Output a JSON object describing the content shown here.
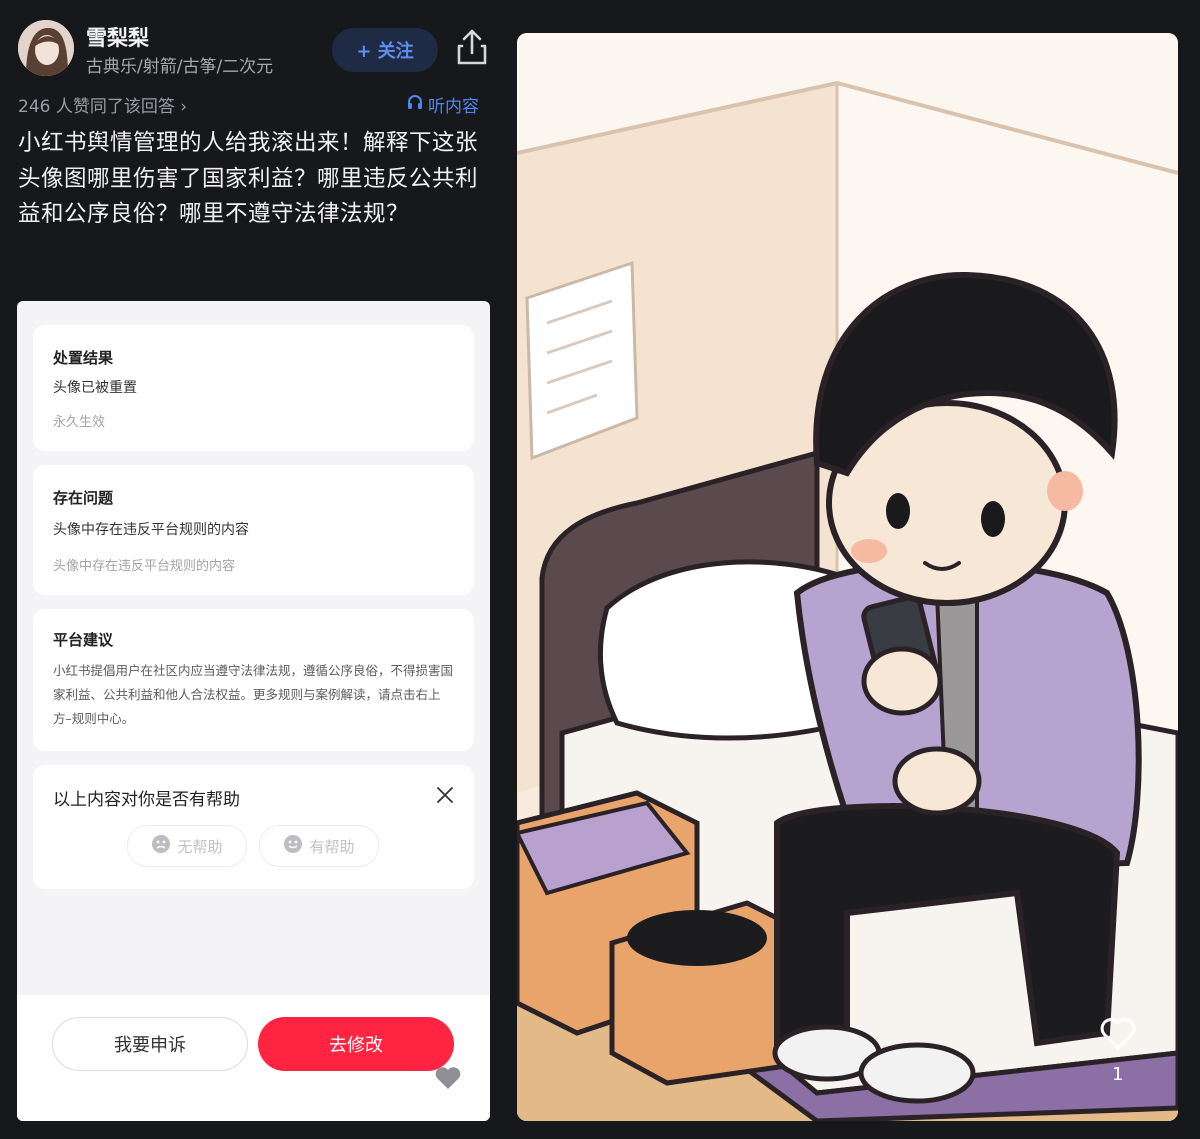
{
  "author": {
    "name": "雪梨梨",
    "tags": "古典乐/射箭/古筝/二次元",
    "follow_label": "+ 关注"
  },
  "answer": {
    "likes_text": "246 人赞同了该回答 ›",
    "listen_label": "听内容",
    "text": "小红书舆情管理的人给我滚出来！解释下这张头像图哪里伤害了国家利益？哪里违反公共利益和公序良俗？哪里不遵守法律法规？"
  },
  "notice": {
    "result": {
      "title": "处置结果",
      "value": "头像已被重置",
      "duration": "永久生效"
    },
    "issue": {
      "title": "存在问题",
      "value": "头像中存在违反平台规则的内容",
      "detail": "头像中存在违反平台规则的内容"
    },
    "advice": {
      "title": "平台建议",
      "text": "小红书提倡用户在社区内应当遵守法律法规，遵循公序良俗，不得损害国家利益、公共利益和他人合法权益。更多规则与案例解读，请点击右上方–规则中心。"
    },
    "feedback": {
      "question": "以上内容对你是否有帮助",
      "not_helpful": "无帮助",
      "helpful": "有帮助"
    },
    "appeal_label": "我要申诉",
    "modify_label": "去修改"
  },
  "image_post": {
    "like_count": "1"
  },
  "colors": {
    "accent_red": "#ff2442",
    "link_blue": "#4f86ef",
    "background": "#17181c"
  },
  "icons": [
    "share-icon",
    "headphones-icon",
    "close-icon",
    "heart-icon"
  ]
}
